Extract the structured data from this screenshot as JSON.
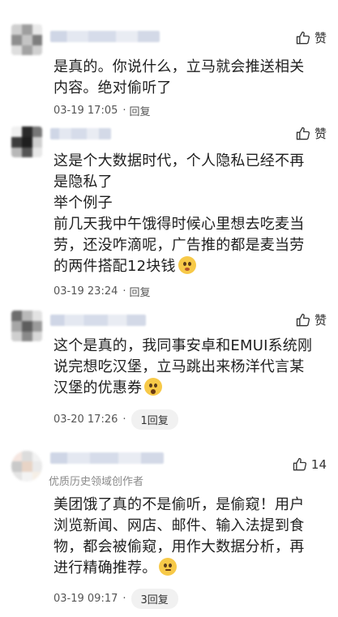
{
  "comments": [
    {
      "text": "是真的。你说什么，立马就会推送相关内容。绝对偷听了",
      "time": "03-19 17:05",
      "reply_label": "回复",
      "like_label": "赞"
    },
    {
      "text": "这是个大数据时代，个人隐私已经不再是隐私了\n举个例子\n前几天我中午饿得时候心里想去吃麦当劳，还没咋滴呢，广告推的都是麦当劳的两件搭配12块钱",
      "time": "03-19 23:24",
      "reply_label": "回复",
      "like_label": "赞",
      "emoji": "smirk-emoji"
    },
    {
      "text": "这个是真的，我同事安卓和EMUI系统刚说完想吃汉堡，立马跳出来杨洋代言某汉堡的优惠券",
      "time": "03-20 17:26",
      "reply_count_label": "1回复",
      "like_label": "赞",
      "emoji": "surprised-emoji"
    },
    {
      "text": "美团饿了真的不是偷听，是偷窥！用户浏览新闻、网店、邮件、输入法提到食物，都会被偷窥，用作大数据分析，再进行精确推荐。",
      "time": "03-19 09:17",
      "reply_count_label": "3回复",
      "like_count": "14",
      "creator_tag": "优质历史领域创作者",
      "emoji": "thinking-emoji"
    }
  ]
}
